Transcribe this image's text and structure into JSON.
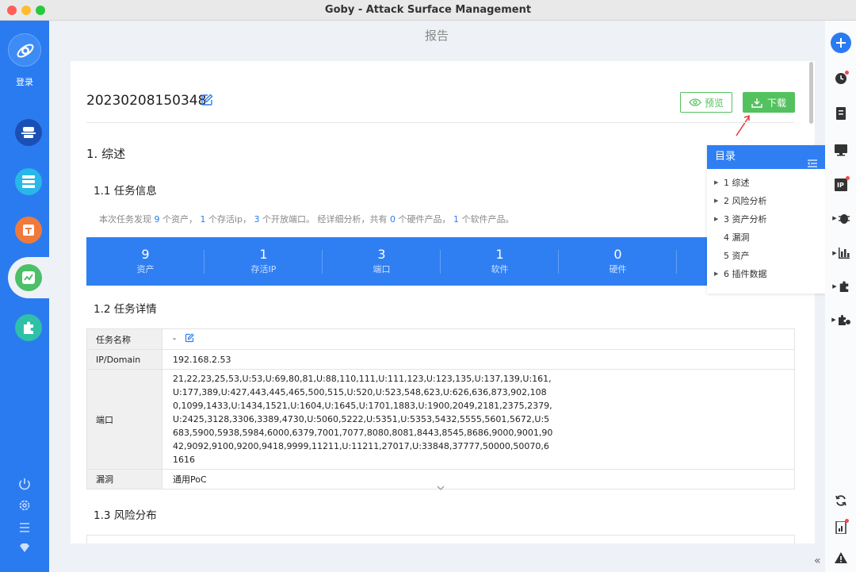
{
  "window": {
    "title": "Goby - Attack Surface Management"
  },
  "sidebar": {
    "login_label": "登录"
  },
  "page": {
    "title": "报告"
  },
  "report": {
    "name": "20230208150348",
    "preview_label": "预览",
    "download_label": "下载"
  },
  "section1": {
    "title": "1. 综述",
    "sub1_title": "1.1 任务信息",
    "summary": {
      "p1": "本次任务发现 ",
      "n1": "9",
      "p2": " 个资产， ",
      "n2": "1",
      "p3": " 个存活ip， ",
      "n3": "3",
      "p4": " 个开放端口。 经详细分析，共有 ",
      "n4": "0",
      "p5": " 个硬件产品， ",
      "n5": "1",
      "p6": " 个软件产品。"
    },
    "stats": [
      {
        "value": "9",
        "label": "资产"
      },
      {
        "value": "1",
        "label": "存活IP"
      },
      {
        "value": "3",
        "label": "端口"
      },
      {
        "value": "1",
        "label": "软件"
      },
      {
        "value": "0",
        "label": "硬件"
      }
    ],
    "sub2_title": "1.2 任务详情",
    "details": {
      "task_name_key": "任务名称",
      "task_name_value": "-",
      "ip_key": "IP/Domain",
      "ip_value": "192.168.2.53",
      "port_key": "端口",
      "port_value": "21,22,23,25,53,U:53,U:69,80,81,U:88,110,111,U:111,123,U:123,135,U:137,139,U:161,U:177,389,U:427,443,445,465,500,515,U:520,U:523,548,623,U:626,636,873,902,1080,1099,1433,U:1434,1521,U:1604,U:1645,U:1701,1883,U:1900,2049,2181,2375,2379,U:2425,3128,3306,3389,4730,U:5060,5222,U:5351,U:5353,5432,5555,5601,5672,U:5683,5900,5938,5984,6000,6379,7001,7077,8080,8081,8443,8545,8686,9000,9001,9042,9092,9100,9200,9418,9999,11211,U:11211,27017,U:33848,37777,50000,50070,61616",
      "vuln_key": "漏洞",
      "vuln_value": "通用PoC"
    },
    "sub3_title": "1.3 风险分布"
  },
  "toc": {
    "title": "目录",
    "items": [
      {
        "label": "1 综述",
        "expandable": true
      },
      {
        "label": "2 风险分析",
        "expandable": true
      },
      {
        "label": "3 资产分析",
        "expandable": true
      },
      {
        "label": "4 漏洞",
        "expandable": false
      },
      {
        "label": "5 资产",
        "expandable": false
      },
      {
        "label": "6 插件数据",
        "expandable": true
      }
    ]
  },
  "colors": {
    "brand_blue": "#2b7bf0",
    "success_green": "#53c25e",
    "alert_red": "#f44444"
  },
  "icons": [
    "logo-icon",
    "edit-icon",
    "eye-icon",
    "download-icon",
    "plus-icon",
    "clock-icon",
    "document-icon",
    "monitor-icon",
    "ip-icon",
    "bug-icon",
    "bar-chart-icon",
    "plugin-icon",
    "refresh-icon",
    "warning-icon",
    "power-icon",
    "gear-icon",
    "menu-icon",
    "diamond-icon",
    "toc-list-icon",
    "chevron-down-icon",
    "collapse-icon"
  ]
}
